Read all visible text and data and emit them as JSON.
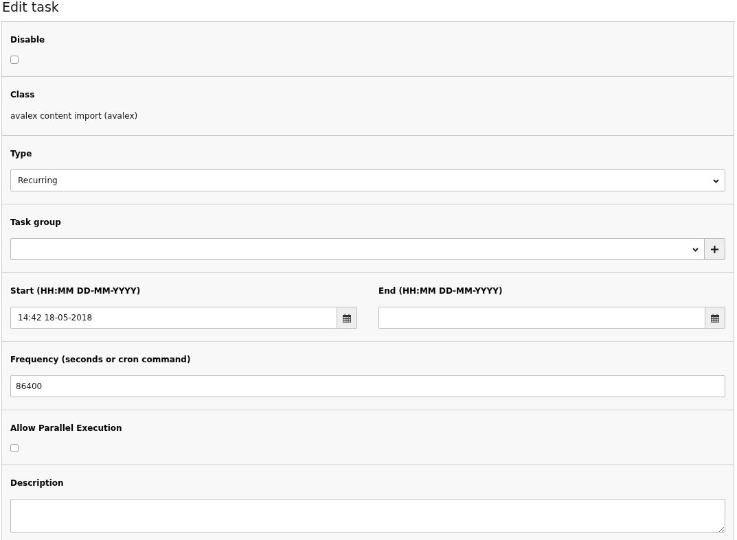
{
  "title": "Edit task",
  "fields": [
    {
      "kind": "checkbox",
      "label": "Disable",
      "checked": false
    },
    {
      "kind": "text",
      "label": "Class",
      "value": "avalex content import (avalex)"
    },
    {
      "kind": "select",
      "label": "Type",
      "value": "Recurring"
    },
    {
      "kind": "select_add",
      "label": "Task group"
    },
    {
      "kind": "dates",
      "columns": [
        {
          "label": "Start (HH:MM DD-MM-YYYY)",
          "value": "14:42 18-05-2018"
        },
        {
          "label": "End (HH:MM DD-MM-YYYY)"
        }
      ]
    },
    {
      "kind": "input",
      "label": "Frequency (seconds or cron command)",
      "value": "86400"
    },
    {
      "kind": "checkbox",
      "label": "Allow Parallel Execution",
      "checked": false
    },
    {
      "kind": "textarea",
      "label": "Description"
    }
  ]
}
